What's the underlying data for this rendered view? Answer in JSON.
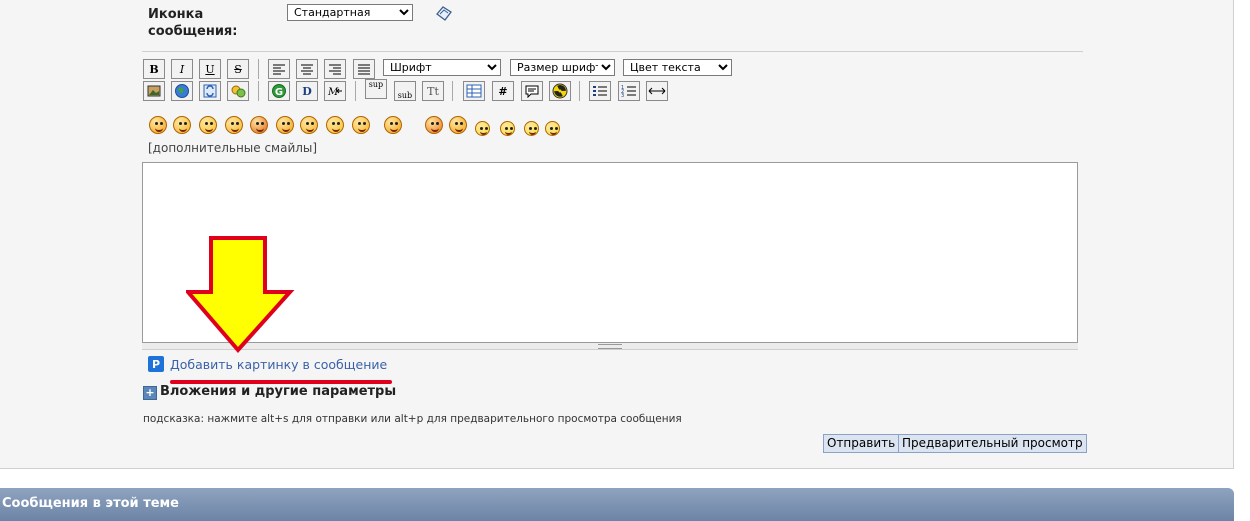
{
  "post_icon": {
    "label": "Иконка сообщения:",
    "selected": "Стандартная"
  },
  "toolbar": {
    "row1": [
      {
        "name": "bold-button",
        "label": "B"
      },
      {
        "name": "italic-button",
        "label": "I"
      },
      {
        "name": "underline-button",
        "label": "U"
      },
      {
        "name": "strike-button",
        "label": "S"
      }
    ],
    "row2_text": [
      {
        "name": "sup-button",
        "label": "sup"
      },
      {
        "name": "sub-button",
        "label": "sub"
      },
      {
        "name": "tt-button",
        "label": "Tt"
      }
    ],
    "font_select": "Шрифт",
    "size_select": "Размер шрифта",
    "color_select": "Цвет текста",
    "hash_label": "#"
  },
  "smilies": {
    "more_link": "[дополнительные смайлы]"
  },
  "add_image": {
    "icon_letter": "P",
    "label": "Добавить картинку в сообщение"
  },
  "attachments": {
    "plus": "+",
    "label": "Вложения и другие параметры"
  },
  "hint": "подсказка: нажмите alt+s для отправки или alt+p для предварительного просмотра сообщения",
  "buttons": {
    "submit": "Отправить",
    "preview": "Предварительный просмотр"
  },
  "thread_section": {
    "title": "Сообщения в этой теме"
  },
  "colors": {
    "annotation_arrow_fill": "#ffff00",
    "annotation_arrow_stroke": "#e0001b",
    "link": "#3b62a8",
    "header_bar": "#7a90b0"
  }
}
